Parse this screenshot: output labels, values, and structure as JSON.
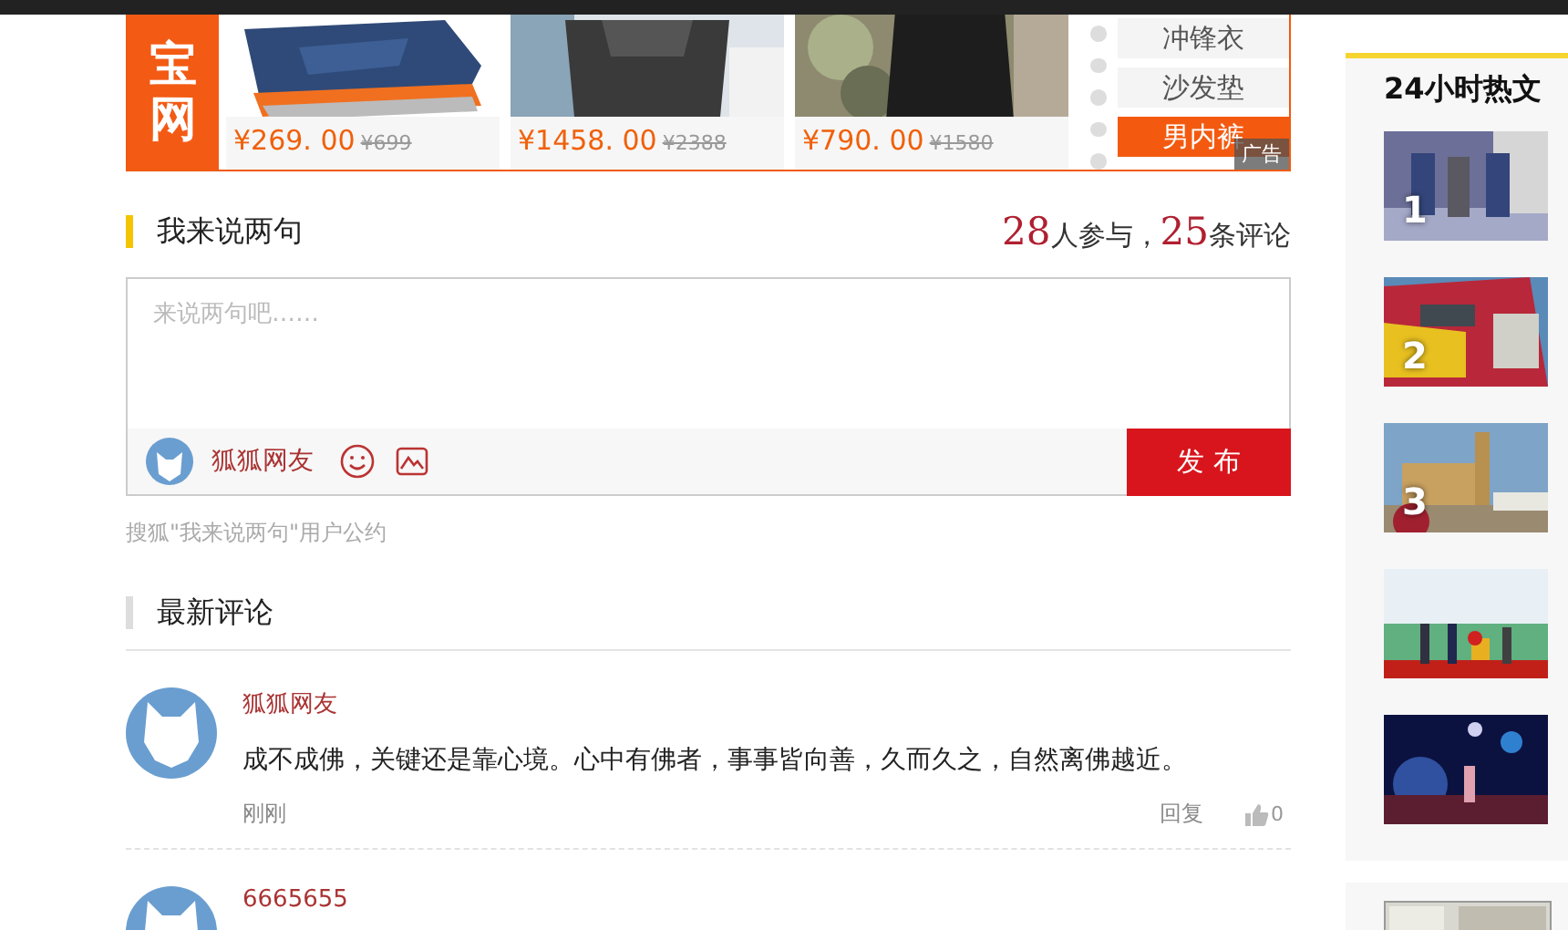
{
  "ad": {
    "logo_text": "宝网",
    "products": [
      {
        "kind": "shoe",
        "price": "¥269. 00",
        "old_price": "¥699"
      },
      {
        "kind": "bag",
        "price": "¥1458. 00",
        "old_price": "¥2388"
      },
      {
        "kind": "jacket",
        "price": "¥790. 00",
        "old_price": "¥1580"
      }
    ],
    "tags": [
      {
        "label": "冲锋衣",
        "selected": false
      },
      {
        "label": "沙发垫",
        "selected": false
      },
      {
        "label": "男内裤",
        "selected": true
      }
    ],
    "badge": "广告"
  },
  "comment_box": {
    "title": "我来说两句",
    "participants": "28",
    "participants_label": "人参与，",
    "comments": "25",
    "comments_label": "条评论",
    "placeholder": "来说两句吧……",
    "user_name": "狐狐网友",
    "submit": "发 布",
    "agreement": "搜狐\"我来说两句\"用户公约"
  },
  "latest": {
    "title": "最新评论",
    "comments": [
      {
        "user": "狐狐网友",
        "text": "成不成佛，关键还是靠心境。心中有佛者，事事皆向善，久而久之，自然离佛越近。",
        "time": "刚刚",
        "reply": "回复",
        "likes": "0"
      },
      {
        "user": "6665655"
      }
    ]
  },
  "hot": {
    "title": "24小时热文",
    "items": [
      {
        "kind": "picture",
        "rank": "1"
      },
      {
        "kind": "picture",
        "rank": "2"
      },
      {
        "kind": "picture",
        "rank": "3"
      },
      {
        "kind": "picture"
      },
      {
        "kind": "picture"
      }
    ]
  }
}
